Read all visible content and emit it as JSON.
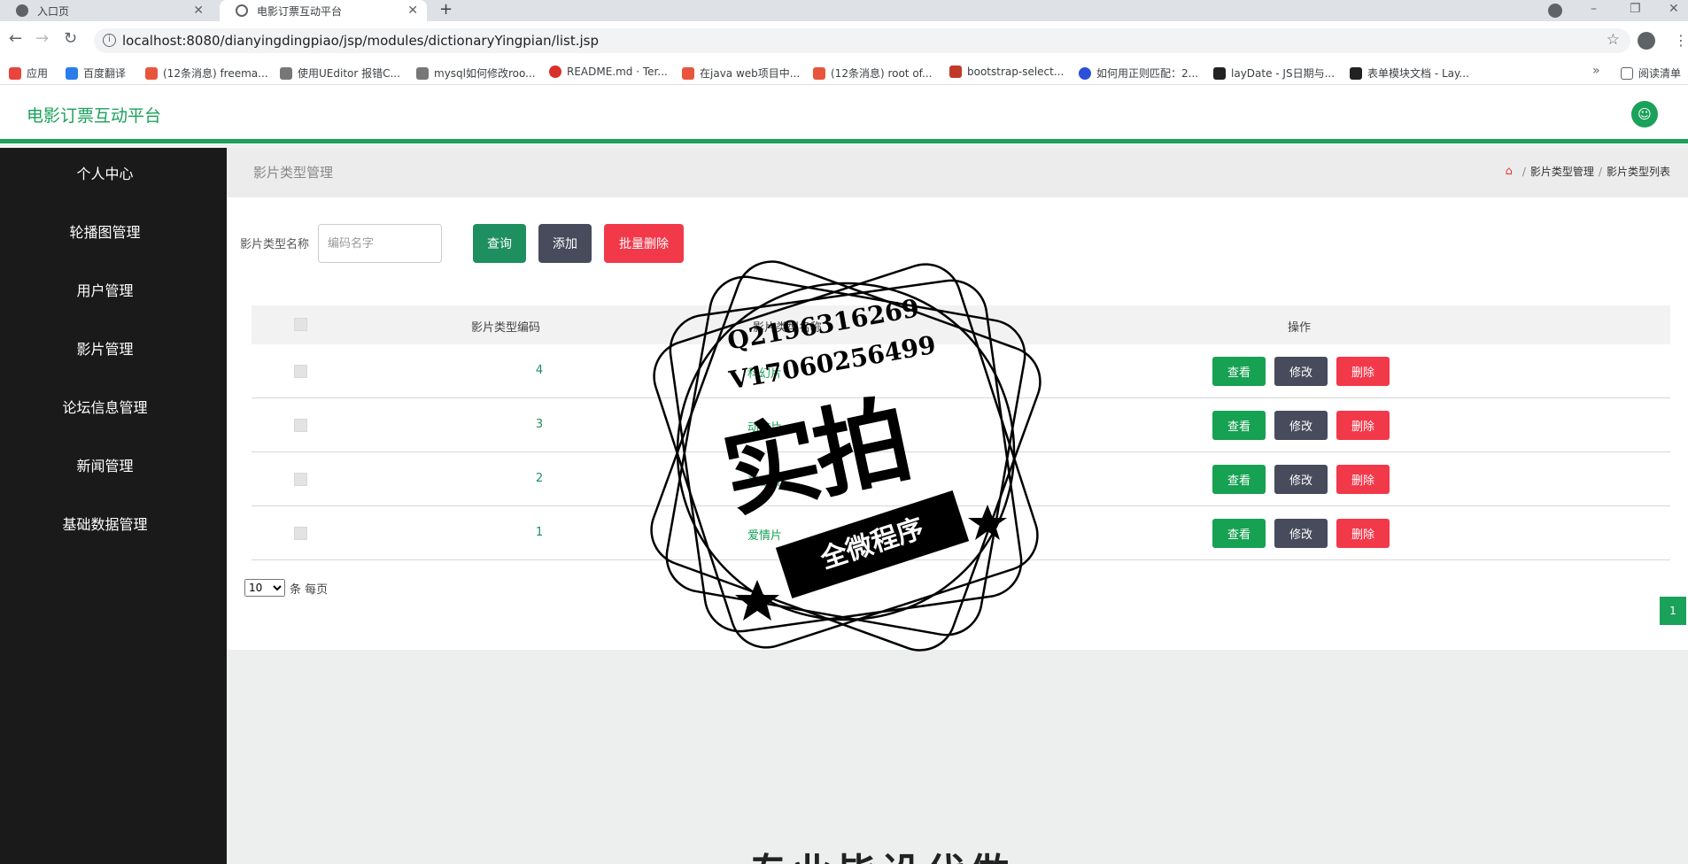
{
  "browser": {
    "tabs": [
      {
        "title": "入口页"
      },
      {
        "title": "电影订票互动平台"
      }
    ],
    "url": "localhost:8080/dianyingdingpiao/jsp/modules/dictionaryYingpian/list.jsp",
    "bookmarks": [
      {
        "label": "应用",
        "color": "#e8453c"
      },
      {
        "label": "百度翻译",
        "color": "#2b7de9"
      },
      {
        "label": "(12条消息) freema...",
        "color": "#e8553c"
      },
      {
        "label": "使用UEditor 报错C...",
        "color": "#555555"
      },
      {
        "label": "mysql如何修改roo...",
        "color": "#555555"
      },
      {
        "label": "README.md · Ter...",
        "color": "#d9302b"
      },
      {
        "label": "在java web项目中...",
        "color": "#e8553c"
      },
      {
        "label": "(12条消息) root of...",
        "color": "#e8553c"
      },
      {
        "label": "bootstrap-select...",
        "color": "#c0392b"
      },
      {
        "label": "如何用正则匹配：2...",
        "color": "#2b4fd6"
      },
      {
        "label": "layDate - JS日期与...",
        "color": "#222222"
      },
      {
        "label": "表单模块文档 - Lay...",
        "color": "#222222"
      },
      {
        "label": "阅读清单",
        "color": "#5f6368"
      }
    ]
  },
  "app": {
    "title": "电影订票互动平台",
    "accent": "#1aa15a"
  },
  "sidebar": {
    "items": [
      {
        "label": "个人中心"
      },
      {
        "label": "轮播图管理"
      },
      {
        "label": "用户管理"
      },
      {
        "label": "影片管理"
      },
      {
        "label": "论坛信息管理"
      },
      {
        "label": "新闻管理"
      },
      {
        "label": "基础数据管理"
      }
    ]
  },
  "breadcrumb": {
    "title": "影片类型管理",
    "path": [
      "影片类型管理",
      "影片类型列表"
    ]
  },
  "search": {
    "label": "影片类型名称",
    "placeholder": "编码名字",
    "query_label": "查询",
    "add_label": "添加",
    "batch_delete_label": "批量删除"
  },
  "table": {
    "headers": {
      "code": "影片类型编码",
      "name": "影片类型名称",
      "actions": "操作"
    },
    "rows": [
      {
        "code": "4",
        "name": "科幻片"
      },
      {
        "code": "3",
        "name": "动作片"
      },
      {
        "code": "2",
        "name": "喜剧片"
      },
      {
        "code": "1",
        "name": "爱情片"
      }
    ],
    "actions": {
      "view": "查看",
      "edit": "修改",
      "delete": "删除"
    }
  },
  "pagination": {
    "page_size": "10",
    "page_size_suffix": "条 每页",
    "current_page": "1"
  },
  "watermark": {
    "line1": "Q2196316269",
    "line2": "V17060256499",
    "big": "实拍",
    "ribbon": "全微程序",
    "bottom": "专业毕设代做"
  }
}
